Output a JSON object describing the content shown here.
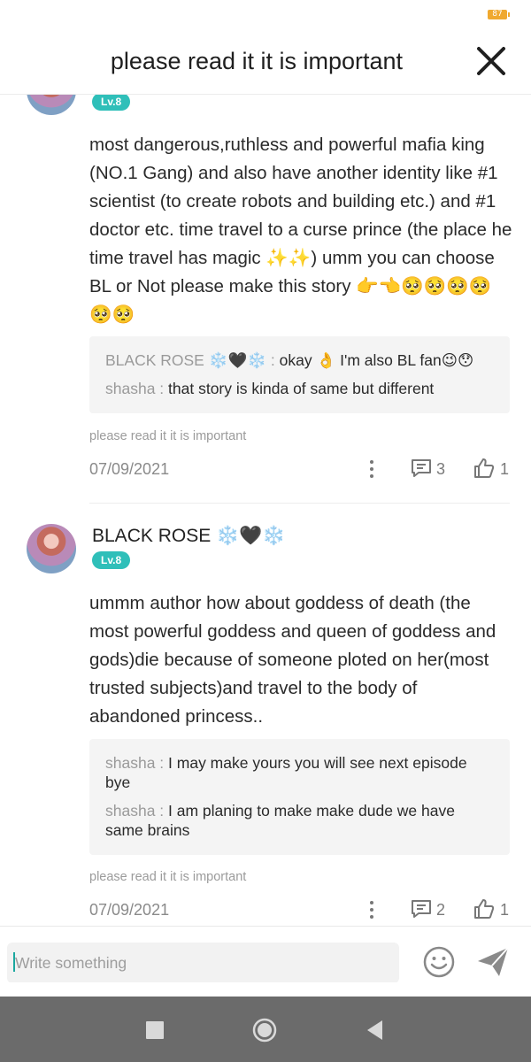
{
  "status_bar": {
    "battery": "87"
  },
  "header": {
    "title": "please read it it is important"
  },
  "comments": [
    {
      "author": "",
      "level": "Lv.8",
      "body": "most dangerous,ruthless and powerful mafia king (NO.1 Gang) and also have another identity like #1 scientist (to create robots and building etc.) and #1 doctor etc. time travel to a curse prince (the place he time travel has magic ✨✨) umm you can choose BL or Not please make this story 👉👈🥺🥺🥺🥺🥺🥺",
      "replies": [
        {
          "name": "BLACK ROSE ❄️🖤❄️ : ",
          "text": "okay 👌 I'm also BL fan😉😯"
        },
        {
          "name": "shasha : ",
          "text": "that story is kinda of same but different"
        }
      ],
      "source": "please read it it is important",
      "date": "07/09/2021",
      "reply_count": "3",
      "like_count": "1"
    },
    {
      "author": "BLACK ROSE ❄️🖤❄️",
      "level": "Lv.8",
      "body": "ummm author how about goddess of death (the most powerful goddess and queen of goddess and gods)die because of someone ploted on her(most trusted subjects)and travel to the body of abandoned princess..",
      "replies": [
        {
          "name": "shasha : ",
          "text": "I may make yours you will see next episode bye"
        },
        {
          "name": "shasha : ",
          "text": "I am planing to make make dude we have same brains"
        }
      ],
      "source": "please read it it is important",
      "date": "07/09/2021",
      "reply_count": "2",
      "like_count": "1"
    }
  ],
  "composer": {
    "placeholder": "Write something"
  },
  "colors": {
    "accent": "#2fbfb9",
    "navbar": "#6b6b6b",
    "battery": "#f0a92f"
  },
  "icons": [
    "close-icon",
    "more-icon",
    "reply-icon",
    "like-icon",
    "emoji-icon",
    "send-icon",
    "nav-recents-icon",
    "nav-home-icon",
    "nav-back-icon"
  ]
}
